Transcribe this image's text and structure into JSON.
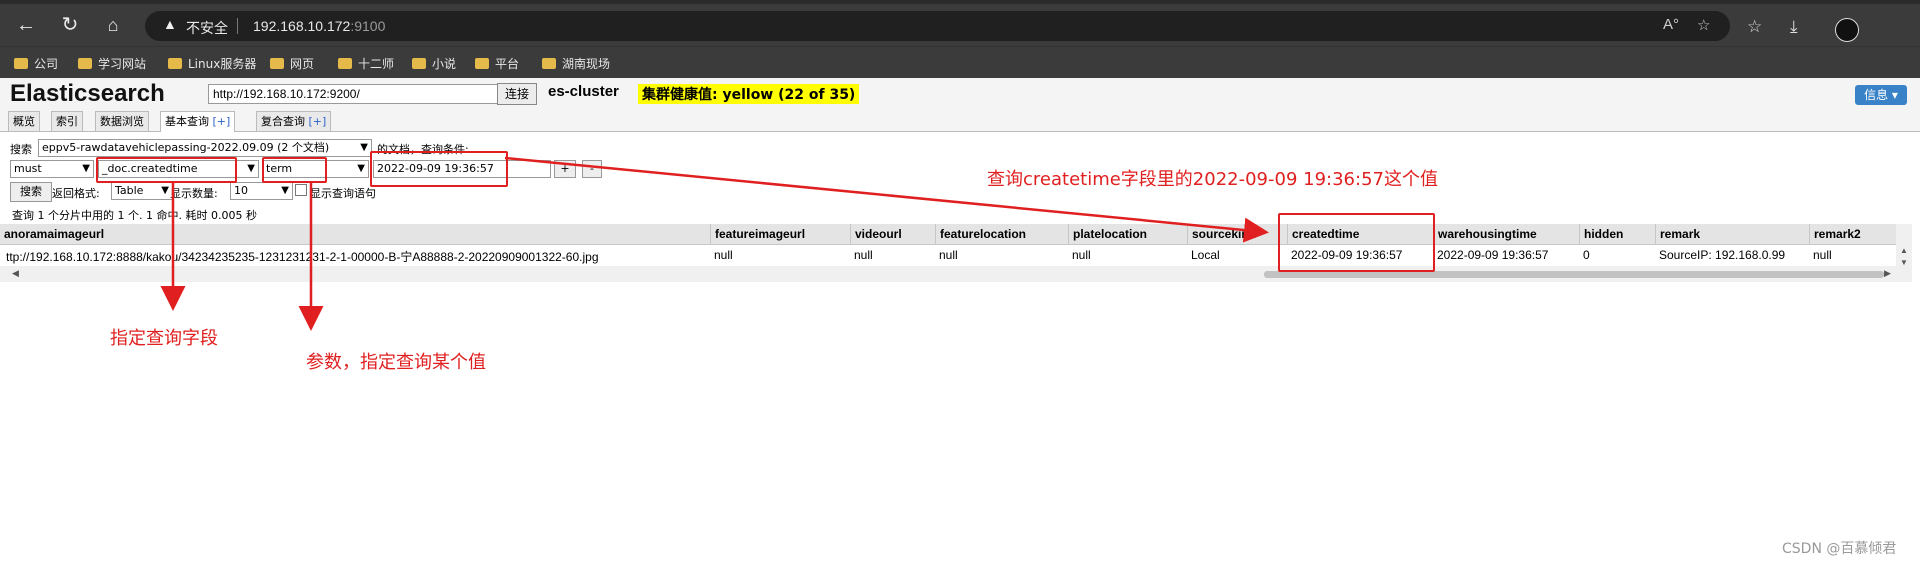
{
  "browser": {
    "insecure_label": "不安全",
    "url_host": "192.168.10.172",
    "url_port": ":9100",
    "bookmarks": [
      "公司",
      "学习网站",
      "Linux服务器",
      "网页",
      "十二师",
      "小说",
      "平台",
      "湖南现场"
    ]
  },
  "app": {
    "title": "Elasticsearch",
    "connection_url": "http://192.168.10.172:9200/",
    "connect_label": "连接",
    "cluster_name": "es-cluster",
    "health": "集群健康值: yellow (22 of 35)",
    "info_label": "信息 ▾"
  },
  "tabs": [
    {
      "label": "概览"
    },
    {
      "label": "索引"
    },
    {
      "label": "数据浏览"
    },
    {
      "label": "基本查询",
      "plus": "[+]"
    },
    {
      "label": "复合查询",
      "plus": "[+]"
    }
  ],
  "query": {
    "search_label": "搜索",
    "index_select": "eppv5-rawdatavehiclepassing-2022.09.09 (2 个文档)",
    "docs_suffix": "的文档，查询条件:",
    "bool_select": "must",
    "field_select": "_doc.createdtime",
    "op_select": "term",
    "value": "2022-09-09 19:36:57",
    "add_label": "+",
    "remove_label": "-",
    "search_button": "搜索",
    "format_label": "返回格式:",
    "format_select": "Table",
    "count_label": "显示数量:",
    "count_select": "10",
    "show_query_label": "显示查询语句",
    "summary": "查询 1 个分片中用的 1 个. 1 命中. 耗时 0.005 秒"
  },
  "table": {
    "columns": [
      "anoramaimageurl",
      "featureimageurl",
      "videourl",
      "featurelocation",
      "platelocation",
      "sourcekind",
      "createdtime",
      "warehousingtime",
      "hidden",
      "remark",
      "remark2"
    ],
    "rows": [
      [
        "ttp://192.168.10.172:8888/kakou/34234235235-1231231231-2-1-00000-B-宁A88888-2-20220909001322-60.jpg",
        "null",
        "null",
        "null",
        "null",
        "Local",
        "2022-09-09 19:36:57",
        "2022-09-09 19:36:57",
        "0",
        "SourceIP: 192.168.0.99",
        "null"
      ]
    ]
  },
  "annotations": {
    "right_note": "查询createtime字段里的2022-09-09 19:36:57这个值",
    "field_note": "指定查询字段",
    "param_note": "参数，指定查询某个值"
  },
  "watermark": "CSDN @百慕倾君"
}
